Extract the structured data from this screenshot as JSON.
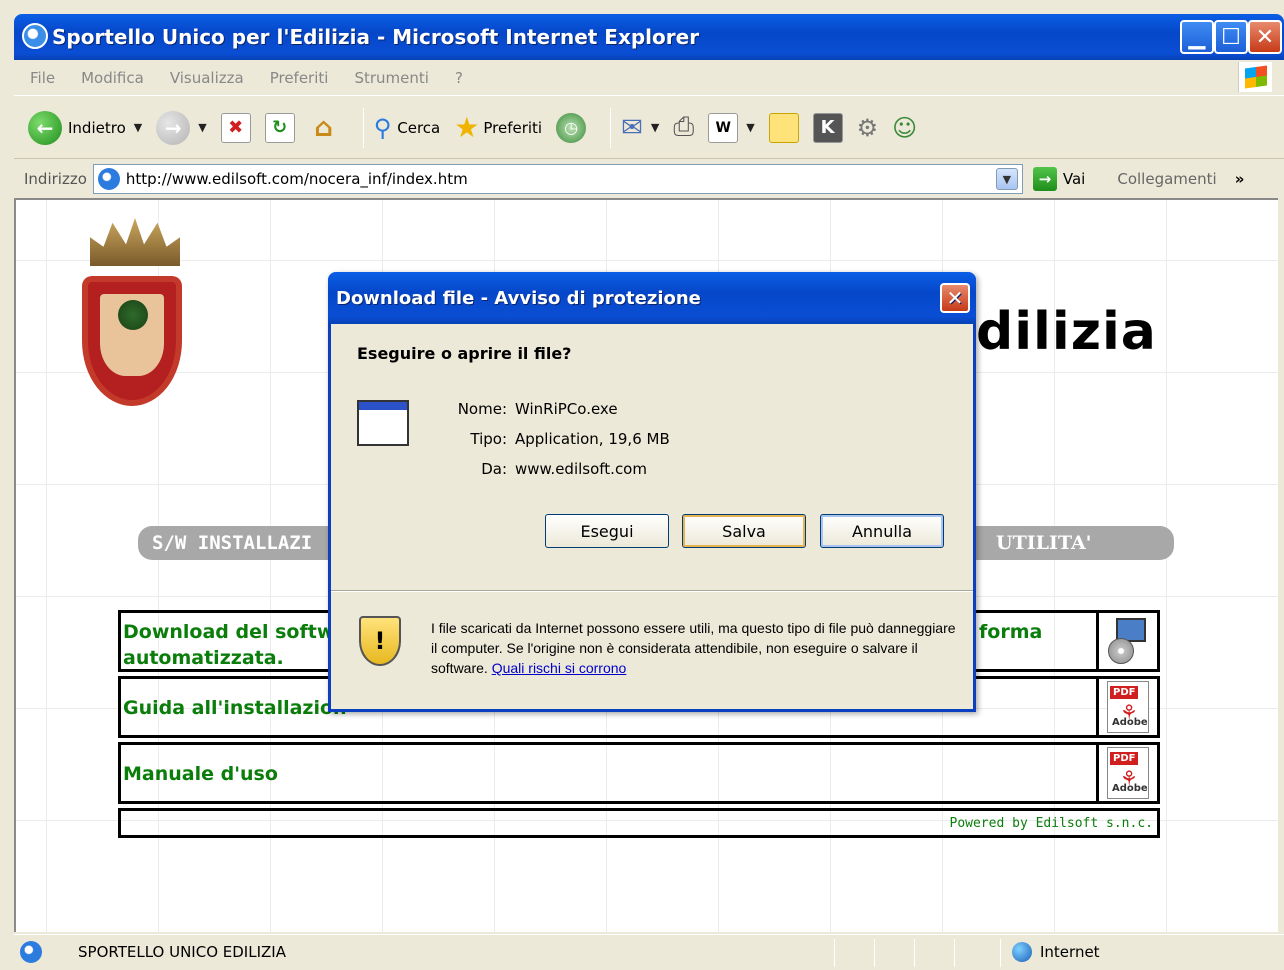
{
  "window": {
    "title": "Sportello Unico per l'Edilizia - Microsoft Internet Explorer",
    "min_glyph": "▁",
    "max_glyph": "☐",
    "close_glyph": "✕"
  },
  "menu": [
    "File",
    "Modifica",
    "Visualizza",
    "Preferiti",
    "Strumenti",
    "?"
  ],
  "toolbar": {
    "back_label": "Indietro",
    "search_label": "Cerca",
    "favorites_label": "Preferiti"
  },
  "address": {
    "label": "Indirizzo",
    "url": "http://www.edilsoft.com/nocera_inf/index.htm",
    "go_label": "Vai",
    "links_label": "Collegamenti",
    "more_glyph": "»"
  },
  "page": {
    "title_partial": "dilizia",
    "menu_left": "S/W INSTALLAZI",
    "menu_right": "UTILITA'",
    "rows": [
      {
        "text_line1": "Download del softw",
        "text_line2": "automatizzata.",
        "text_right": "forma"
      },
      {
        "text_line1": "Guida all'installazion",
        "text_line2": "",
        "text_right": ""
      },
      {
        "text_line1": "Manuale d'uso",
        "text_line2": "",
        "text_right": ""
      }
    ],
    "pdf_tag": "PDF",
    "pdf_adobe": "Adobe",
    "powered": "Powered by Edilsoft s.n.c."
  },
  "dialog": {
    "title": "Download file - Avviso di protezione",
    "close_glyph": "✕",
    "question": "Eseguire o aprire il file?",
    "name_label": "Nome:",
    "name_value": "WinRiPCo.exe",
    "type_label": "Tipo:",
    "type_value": "Application, 19,6 MB",
    "from_label": "Da:",
    "from_value": "www.edilsoft.com",
    "run_label": "Esegui",
    "save_label": "Salva",
    "cancel_label": "Annulla",
    "warning_glyph": "!",
    "warning_text": "I file scaricati da Internet possono essere utili, ma questo tipo di file può danneggiare il computer. Se l'origine non è considerata attendibile, non eseguire o salvare il software.",
    "warning_link": "Quali rischi si corrono"
  },
  "status": {
    "text": "SPORTELLO UNICO EDILIZIA",
    "zone": "Internet"
  }
}
